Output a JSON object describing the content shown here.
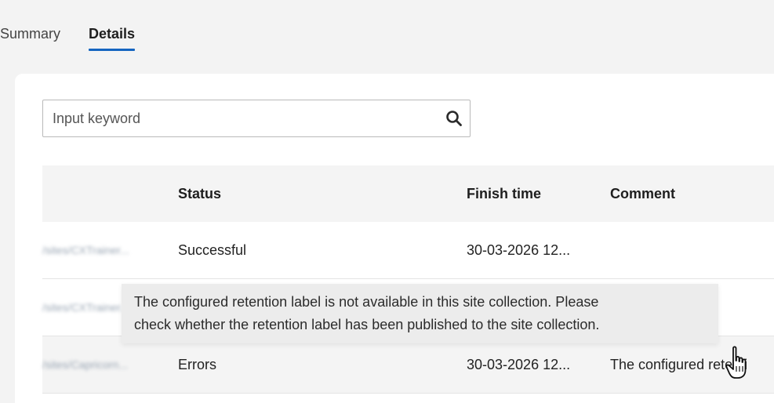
{
  "tabs": [
    {
      "label": "Summary",
      "active": false
    },
    {
      "label": "Details",
      "active": true
    }
  ],
  "search": {
    "placeholder": "Input keyword",
    "value": ""
  },
  "table": {
    "headers": [
      "",
      "Status",
      "Finish time",
      "Comment"
    ],
    "rows": [
      {
        "name": "/sites/CXTrainer...",
        "status": "Successful",
        "finish_time": "30-03-2026 12...",
        "comment": ""
      },
      {
        "name": "/sites/CXTrainer...",
        "status": "",
        "finish_time": "",
        "comment": ""
      },
      {
        "name": "/sites/Capricorn...",
        "status": "Errors",
        "finish_time": "30-03-2026 12...",
        "comment": "The configured retenti"
      }
    ]
  },
  "tooltip": {
    "text_line1": "The configured retention label is not available in this site collection. Please",
    "text_line2": "check whether the retention label has been published to the site collection."
  },
  "colors": {
    "background": "#f3f3f3",
    "panel": "#ffffff",
    "accent": "#1565c0",
    "header_bg": "#f4f4f4",
    "tooltip_bg": "#ececec"
  },
  "icons": {
    "search": "search-icon",
    "cursor": "hand-pointer-icon"
  }
}
